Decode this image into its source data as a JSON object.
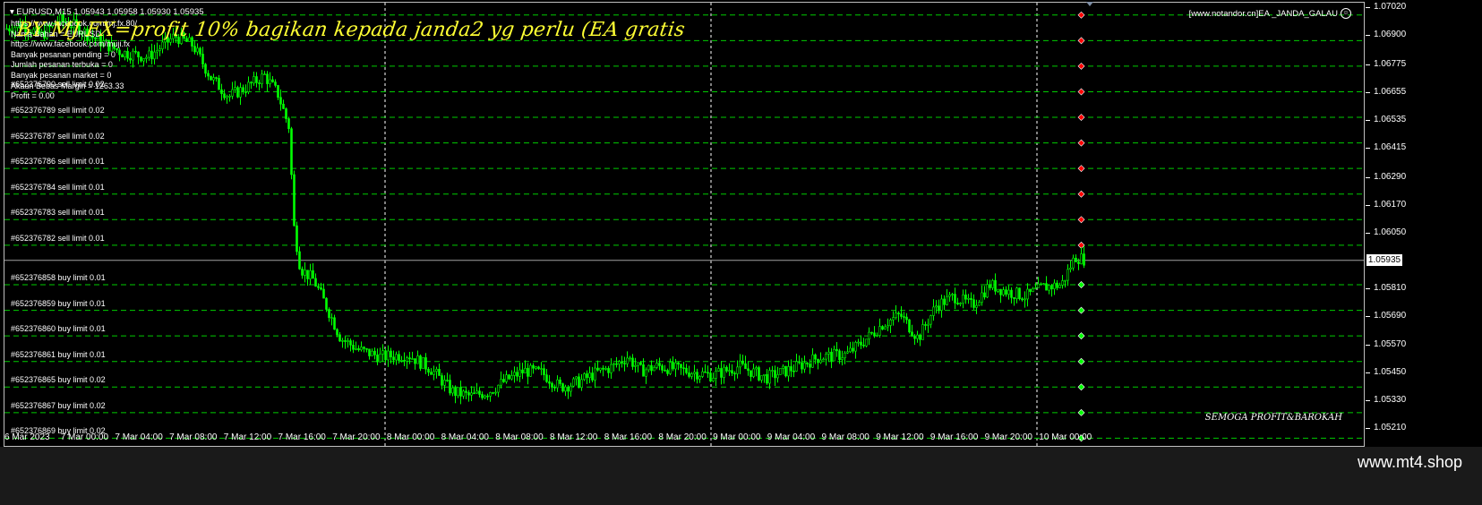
{
  "chart": {
    "symbol": "EURUSD,M15",
    "ohlc": "1.05943 1.05958 1.05930 1.05935",
    "ea_tag": "[www.notandor.cn]EA _JANDA_GALAU",
    "ea_tag_icon": "smiley-icon",
    "banner": "BY MJ FX=profit 10% bagikan kepada janda2 yg perlu (EA gratis",
    "info_lines": [
      "https://www.facebook.com/mj.fx.80/",
      "Nama Bahan = EURUSD",
      "https://www.facebook.com/muji.fx",
      "Banyak pesanan pending = 0",
      "Jumlah pesanan terbuka = 0",
      "Banyak pesanan market = 0",
      "Akaun Bebas Margin = 1263.33",
      "Profit = 0.00"
    ],
    "current_price": "1.05935",
    "watermark": "SEMOGA PROFIT&BAROKAH",
    "colors": {
      "background": "#000000",
      "candle": "#00ff00",
      "grid": "#ffffff",
      "sell_marker": "#ff0000",
      "buy_marker": "#00ff00",
      "order_line": "#00cc00"
    }
  },
  "price_axis": {
    "labels": [
      "1.07020",
      "1.06900",
      "1.06775",
      "1.06655",
      "1.06535",
      "1.06415",
      "1.06290",
      "1.06170",
      "1.06050",
      "1.05935",
      "1.05810",
      "1.05690",
      "1.05570",
      "1.05450",
      "1.05330",
      "1.05210"
    ],
    "min": 1.0521,
    "max": 1.0702
  },
  "time_axis": {
    "labels": [
      "6 Mar 2023",
      "7 Mar 00:00",
      "7 Mar 04:00",
      "7 Mar 08:00",
      "7 Mar 12:00",
      "7 Mar 16:00",
      "7 Mar 20:00",
      "8 Mar 00:00",
      "8 Mar 04:00",
      "8 Mar 08:00",
      "8 Mar 12:00",
      "8 Mar 16:00",
      "8 Mar 20:00",
      "9 Mar 00:00",
      "9 Mar 04:00",
      "9 Mar 08:00",
      "9 Mar 12:00",
      "9 Mar 16:00",
      "9 Mar 20:00",
      "10 Mar 00:00"
    ]
  },
  "orders": [
    {
      "label": "#652376790 sell limit 0.02",
      "type": "sell",
      "price": 1.0666
    },
    {
      "label": "#652376789 sell limit 0.02",
      "type": "sell",
      "price": 1.0655
    },
    {
      "label": "#652376787 sell limit 0.02",
      "type": "sell",
      "price": 1.0644
    },
    {
      "label": "#652376786 sell limit 0.01",
      "type": "sell",
      "price": 1.0633
    },
    {
      "label": "#652376784 sell limit 0.01",
      "type": "sell",
      "price": 1.0622
    },
    {
      "label": "#652376783 sell limit 0.01",
      "type": "sell",
      "price": 1.0611
    },
    {
      "label": "#652376782 sell limit 0.01",
      "type": "sell",
      "price": 1.06
    },
    {
      "label": "#652376858 buy limit 0.01",
      "type": "buy",
      "price": 1.0583
    },
    {
      "label": "#652376859 buy limit 0.01",
      "type": "buy",
      "price": 1.0572
    },
    {
      "label": "#652376860 buy limit 0.01",
      "type": "buy",
      "price": 1.0561
    },
    {
      "label": "#652376861 buy limit 0.01",
      "type": "buy",
      "price": 1.055
    },
    {
      "label": "#652376865 buy limit 0.02",
      "type": "buy",
      "price": 1.0539
    },
    {
      "label": "#652376867 buy limit 0.02",
      "type": "buy",
      "price": 1.0528
    },
    {
      "label": "#652376869 buy limit 0.02",
      "type": "buy",
      "price": 1.0517
    }
  ],
  "extra_order_levels": [
    {
      "type": "sell",
      "price": 1.0699
    },
    {
      "type": "sell",
      "price": 1.0688
    },
    {
      "type": "sell",
      "price": 1.0677
    }
  ],
  "price_path": [
    [
      0,
      1.0693
    ],
    [
      20,
      1.0695
    ],
    [
      40,
      1.069
    ],
    [
      60,
      1.0697
    ],
    [
      80,
      1.0694
    ],
    [
      100,
      1.0689
    ],
    [
      130,
      1.0683
    ],
    [
      160,
      1.0681
    ],
    [
      190,
      1.069
    ],
    [
      210,
      1.0686
    ],
    [
      230,
      1.0672
    ],
    [
      250,
      1.0664
    ],
    [
      270,
      1.0668
    ],
    [
      290,
      1.0673
    ],
    [
      305,
      1.0665
    ],
    [
      318,
      1.065
    ],
    [
      322,
      1.061
    ],
    [
      330,
      1.059
    ],
    [
      345,
      1.0585
    ],
    [
      360,
      1.0573
    ],
    [
      375,
      1.056
    ],
    [
      395,
      1.0555
    ],
    [
      420,
      1.0552
    ],
    [
      450,
      1.0553
    ],
    [
      475,
      1.0547
    ],
    [
      500,
      1.0537
    ],
    [
      520,
      1.0535
    ],
    [
      540,
      1.0537
    ],
    [
      560,
      1.0542
    ],
    [
      580,
      1.0546
    ],
    [
      600,
      1.0545
    ],
    [
      620,
      1.0539
    ],
    [
      640,
      1.0541
    ],
    [
      660,
      1.0545
    ],
    [
      680,
      1.0548
    ],
    [
      695,
      1.0552
    ],
    [
      710,
      1.0546
    ],
    [
      730,
      1.0548
    ],
    [
      760,
      1.0546
    ],
    [
      790,
      1.0544
    ],
    [
      820,
      1.0548
    ],
    [
      850,
      1.0543
    ],
    [
      880,
      1.0547
    ],
    [
      910,
      1.0552
    ],
    [
      940,
      1.0553
    ],
    [
      960,
      1.0559
    ],
    [
      980,
      1.0566
    ],
    [
      1000,
      1.057
    ],
    [
      1020,
      1.056
    ],
    [
      1040,
      1.0574
    ],
    [
      1060,
      1.0578
    ],
    [
      1080,
      1.0574
    ],
    [
      1100,
      1.0583
    ],
    [
      1120,
      1.058
    ],
    [
      1140,
      1.0578
    ],
    [
      1160,
      1.0582
    ],
    [
      1180,
      1.0583
    ],
    [
      1195,
      1.0595
    ],
    [
      1205,
      1.0594
    ]
  ]
}
